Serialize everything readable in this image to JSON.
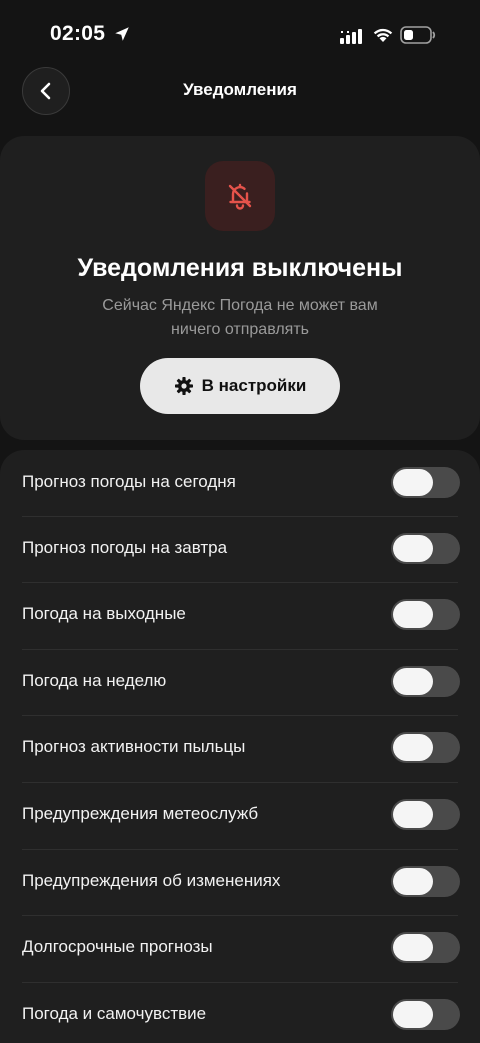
{
  "status_bar": {
    "time": "02:05",
    "icons": [
      "location-arrow-icon",
      "cellular-signal-icon",
      "wifi-icon",
      "battery-icon"
    ]
  },
  "header": {
    "title": "Уведомления",
    "back_icon": "chevron-left-icon"
  },
  "alert": {
    "icon": "bell-off-icon",
    "title": "Уведомления выключены",
    "subtitle": "Сейчас Яндекс Погода не может вам ничего отправлять",
    "button_icon": "gear-icon",
    "button_label": "В настройки"
  },
  "toggles": [
    {
      "label": "Прогноз погоды на сегодня",
      "on": false
    },
    {
      "label": "Прогноз погоды на завтра",
      "on": false
    },
    {
      "label": "Погода на выходные",
      "on": false
    },
    {
      "label": "Погода на неделю",
      "on": false
    },
    {
      "label": "Прогноз активности пыльцы",
      "on": false
    },
    {
      "label": "Предупреждения метеослужб",
      "on": false
    },
    {
      "label": "Предупреждения об изменениях",
      "on": false
    },
    {
      "label": "Долгосрочные прогнозы",
      "on": false
    },
    {
      "label": "Погода и самочувствие",
      "on": false
    }
  ],
  "colors": {
    "background": "#141414",
    "card": "#1f1f1f",
    "alert_icon_red": "#e5534b",
    "alert_icon_bg": "#3a1f1f",
    "button_bg": "#e8e8e8",
    "toggle_track_off": "#4a4a4a"
  }
}
